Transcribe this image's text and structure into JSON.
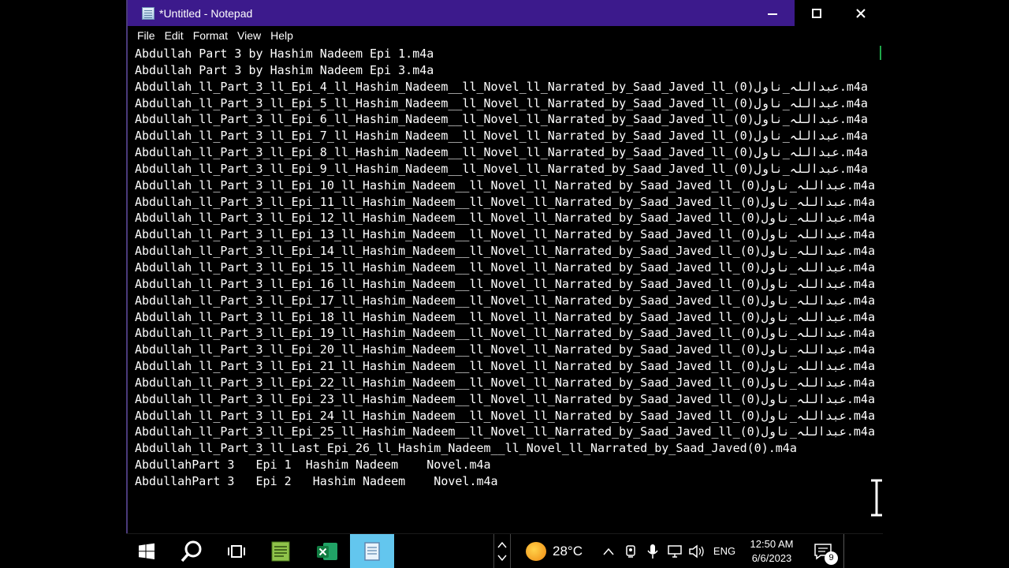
{
  "window": {
    "title": "*Untitled - Notepad",
    "minimize": "–",
    "maximize": "□",
    "close": "×"
  },
  "menu": [
    "File",
    "Edit",
    "Format",
    "View",
    "Help"
  ],
  "lines": [
    "Abdullah Part 3 by Hashim Nadeem Epi 1.m4a",
    "Abdullah Part 3 by Hashim Nadeem Epi 3.m4a",
    "Abdullah_ll_Part_3_ll_Epi_4_ll_Hashim_Nadeem__ll_Novel_ll_Narrated_by_Saad_Javed_ll_عبداللہ_ناول(0).m4a",
    "Abdullah_ll_Part_3_ll_Epi_5_ll_Hashim_Nadeem__ll_Novel_ll_Narrated_by_Saad_Javed_ll_عبداللہ_ناول(0).m4a",
    "Abdullah_ll_Part_3_ll_Epi_6_ll_Hashim_Nadeem__ll_Novel_ll_Narrated_by_Saad_Javed_ll_عبداللہ_ناول(0).m4a",
    "Abdullah_ll_Part_3_ll_Epi_7_ll_Hashim_Nadeem__ll_Novel_ll_Narrated_by_Saad_Javed_ll_عبداللہ_ناول(0).m4a",
    "Abdullah_ll_Part_3_ll_Epi_8_ll_Hashim_Nadeem__ll_Novel_ll_Narrated_by_Saad_Javed_ll_عبداللہ_ناول(0).m4a",
    "Abdullah_ll_Part_3_ll_Epi_9_ll_Hashim_Nadeem__ll_Novel_ll_Narrated_by_Saad_Javed_ll_عبداللہ_ناول(0).m4a",
    "Abdullah_ll_Part_3_ll_Epi_10_ll_Hashim_Nadeem__ll_Novel_ll_Narrated_by_Saad_Javed_ll_عبداللہ_ناول(0).m4a",
    "Abdullah_ll_Part_3_ll_Epi_11_ll_Hashim_Nadeem__ll_Novel_ll_Narrated_by_Saad_Javed_ll_عبداللہ_ناول(0).m4a",
    "Abdullah_ll_Part_3_ll_Epi_12_ll_Hashim_Nadeem__ll_Novel_ll_Narrated_by_Saad_Javed_ll_عبداللہ_ناول(0).m4a",
    "Abdullah_ll_Part_3_ll_Epi_13_ll_Hashim_Nadeem__ll_Novel_ll_Narrated_by_Saad_Javed_ll_عبداللہ_ناول(0).m4a",
    "Abdullah_ll_Part_3_ll_Epi_14_ll_Hashim_Nadeem__ll_Novel_ll_Narrated_by_Saad_Javed_ll_عبداللہ_ناول(0).m4a",
    "Abdullah_ll_Part_3_ll_Epi_15_ll_Hashim_Nadeem__ll_Novel_ll_Narrated_by_Saad_Javed_ll_عبداللہ_ناول(0).m4a",
    "Abdullah_ll_Part_3_ll_Epi_16_ll_Hashim_Nadeem__ll_Novel_ll_Narrated_by_Saad_Javed_ll_عبداللہ_ناول(0).m4a",
    "Abdullah_ll_Part_3_ll_Epi_17_ll_Hashim_Nadeem__ll_Novel_ll_Narrated_by_Saad_Javed_ll_عبداللہ_ناول(0).m4a",
    "Abdullah_ll_Part_3_ll_Epi_18_ll_Hashim_Nadeem__ll_Novel_ll_Narrated_by_Saad_Javed_ll_عبداللہ_ناول(0).m4a",
    "Abdullah_ll_Part_3_ll_Epi_19_ll_Hashim_Nadeem__ll_Novel_ll_Narrated_by_Saad_Javed_ll_عبداللہ_ناول(0).m4a",
    "Abdullah_ll_Part_3_ll_Epi_20_ll_Hashim_Nadeem__ll_Novel_ll_Narrated_by_Saad_Javed_ll_عبداللہ_ناول(0).m4a",
    "Abdullah_ll_Part_3_ll_Epi_21_ll_Hashim_Nadeem__ll_Novel_ll_Narrated_by_Saad_Javed_ll_عبداللہ_ناول(0).m4a",
    "Abdullah_ll_Part_3_ll_Epi_22_ll_Hashim_Nadeem__ll_Novel_ll_Narrated_by_Saad_Javed_ll_عبداللہ_ناول(0).m4a",
    "Abdullah_ll_Part_3_ll_Epi_23_ll_Hashim_Nadeem__ll_Novel_ll_Narrated_by_Saad_Javed_ll_عبداللہ_ناول(0).m4a",
    "Abdullah_ll_Part_3_ll_Epi_24_ll_Hashim_Nadeem__ll_Novel_ll_Narrated_by_Saad_Javed_ll_عبداللہ_ناول(0).m4a",
    "Abdullah_ll_Part_3_ll_Epi_25_ll_Hashim_Nadeem__ll_Novel_ll_Narrated_by_Saad_Javed_ll_عبداللہ_ناول(0).m4a",
    "Abdullah_ll_Part_3_ll_Last_Epi_26_ll_Hashim_Nadeem__ll_Novel_ll_Narrated_by_Saad_Javed(0).m4a",
    "AbdullahPart 3   Epi 1  Hashim Nadeem    Novel.m4a",
    "AbdullahPart 3   Epi 2   Hashim Nadeem    Novel.m4a"
  ],
  "taskbar": {
    "temperature": "28°C",
    "language": "ENG",
    "time": "12:50 AM",
    "date": "6/6/2023",
    "notification_count": "9",
    "accent_active": "#63c6ee",
    "titlebar_color": "#3c1a8c"
  }
}
